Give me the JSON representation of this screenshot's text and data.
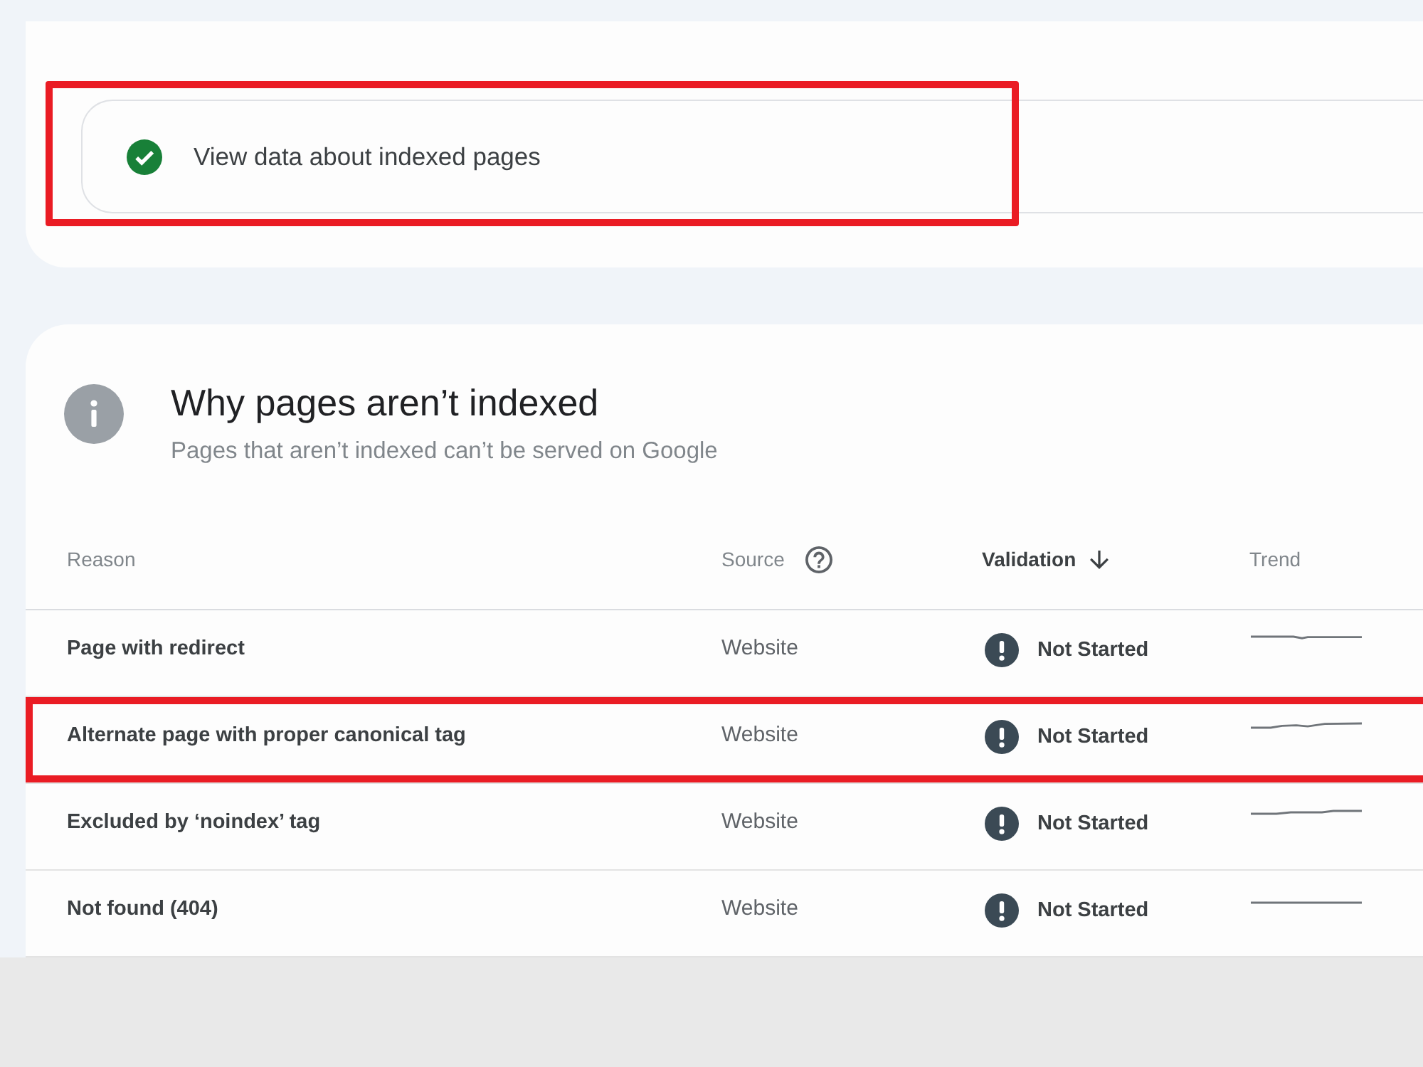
{
  "indexed_link": {
    "label": "View data about indexed pages",
    "highlighted": true
  },
  "section": {
    "title": "Why pages aren’t indexed",
    "subtitle": "Pages that aren’t indexed can’t be served on Google"
  },
  "table": {
    "columns": [
      {
        "label": "Reason",
        "sorted": false,
        "help": false
      },
      {
        "label": "Source",
        "sorted": false,
        "help": true
      },
      {
        "label": "Validation",
        "sorted": true,
        "help": false
      },
      {
        "label": "Trend",
        "sorted": false,
        "help": false
      }
    ],
    "rows": [
      {
        "reason": "Page with redirect",
        "source": "Website",
        "validation": "Not Started",
        "highlighted": false
      },
      {
        "reason": "Alternate page with proper canonical tag",
        "source": "Website",
        "validation": "Not Started",
        "highlighted": true
      },
      {
        "reason": "Excluded by ‘noindex’ tag",
        "source": "Website",
        "validation": "Not Started",
        "highlighted": false
      },
      {
        "reason": "Not found (404)",
        "source": "Website",
        "validation": "Not Started",
        "highlighted": false
      }
    ]
  }
}
